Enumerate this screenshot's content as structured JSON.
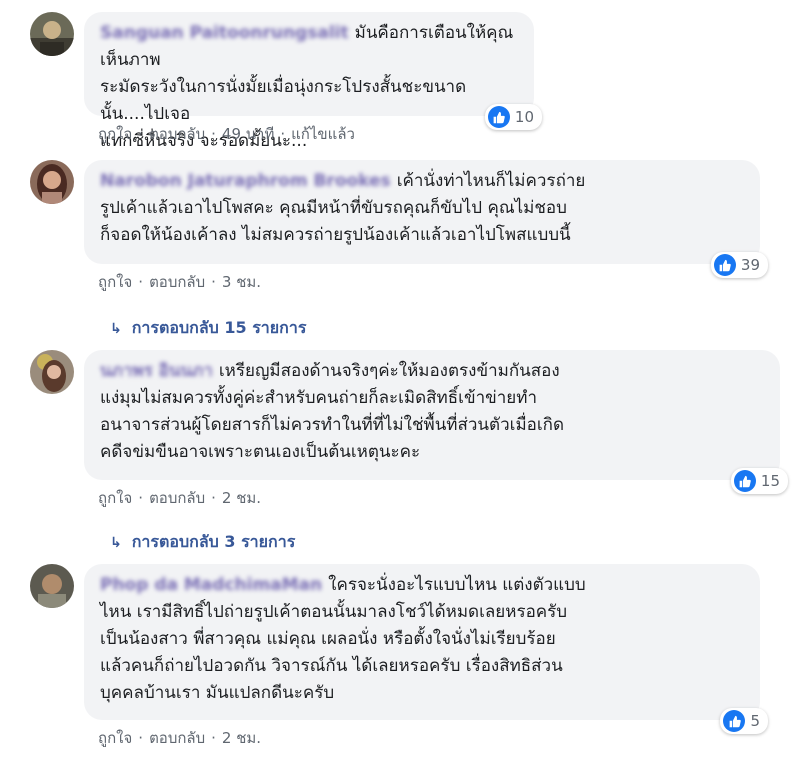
{
  "comments": [
    {
      "author": "Sanguan Paitoonrungsalit",
      "text": "มันคือการเตือนให้คุณเห็นภาพ\nระมัดระวังในการนั่งมั้ยเมื่อนุ่งกระโปรงสั้นชะขนาดนั้น....ไปเจอ\nแทกซี่หื่นจริง จะรอดมั้ยนะ...",
      "like": "ถูกใจ",
      "reply": "ตอบกลับ",
      "time": "49 นาที",
      "edited": "แก้ไขแล้ว",
      "reactions": "10"
    },
    {
      "author": "Narobon Jaturaphrom Brookes",
      "text": "เค้านั่งท่าไหนก็ไม่ควรถ่าย\nรูปเค้าแล้วเอาไปโพสคะ คุณมีหน้าที่ขับรถคุณก็ขับไป คุณไม่ชอบ\nก็จอดให้น้องเค้าลง ไม่สมควรถ่ายรูปน้องเค้าแล้วเอาไปโพสแบบนี้",
      "like": "ถูกใจ",
      "reply": "ตอบกลับ",
      "time": "3 ชม.",
      "reactions": "39",
      "replies_label": "การตอบกลับ 15 รายการ"
    },
    {
      "author": "นภาพร อินนภา",
      "text": "เหรียญมีสองด้านจริงๆค่ะให้มองตรงข้ามกันสอง\nแง่มุมไม่สมควรทั้งคู่ค่ะสำหรับคนถ่ายก็ละเมิดสิทธิ์เข้าข่ายทำ\nอนาจารส่วนผู้โดยสารก็ไม่ควรทำในที่ที่ไม่ใช่พื้นที่ส่วนตัวเมื่อเกิด\nคดีจข่มขืนอาจเพราะตนเองเป็นต้นเหตุนะคะ",
      "like": "ถูกใจ",
      "reply": "ตอบกลับ",
      "time": "2 ชม.",
      "reactions": "15",
      "replies_label": "การตอบกลับ 3 รายการ"
    },
    {
      "author": "Phop da MadchimaMan",
      "text": "ใครจะนั่งอะไรแบบไหน แต่งตัวแบบ\nไหน เรามีสิทธิ์ไปถ่ายรูปเค้าตอนนั้นมาลงโชว์ได้หมดเลยหรอครับ\nเป็นน้องสาว พี่สาวคุณ แม่คุณ เผลอนั่ง หรือตั้งใจนั่งไม่เรียบร้อย\nแล้วคนก็ถ่ายไปอวดกัน วิจารณ์กัน ได้เลยหรอครับ เรื่องสิทธิส่วน\nบุคคลบ้านเรา มันแปลกดีนะครับ",
      "like": "ถูกใจ",
      "reply": "ตอบกลับ",
      "time": "2 ชม.",
      "reactions": "5"
    }
  ],
  "separator": "·",
  "reply_arrow": "↳",
  "colors": {
    "bubble": "#f2f3f5",
    "like_blue": "#1877f2",
    "link_blue": "#385898",
    "meta_gray": "#606770"
  }
}
